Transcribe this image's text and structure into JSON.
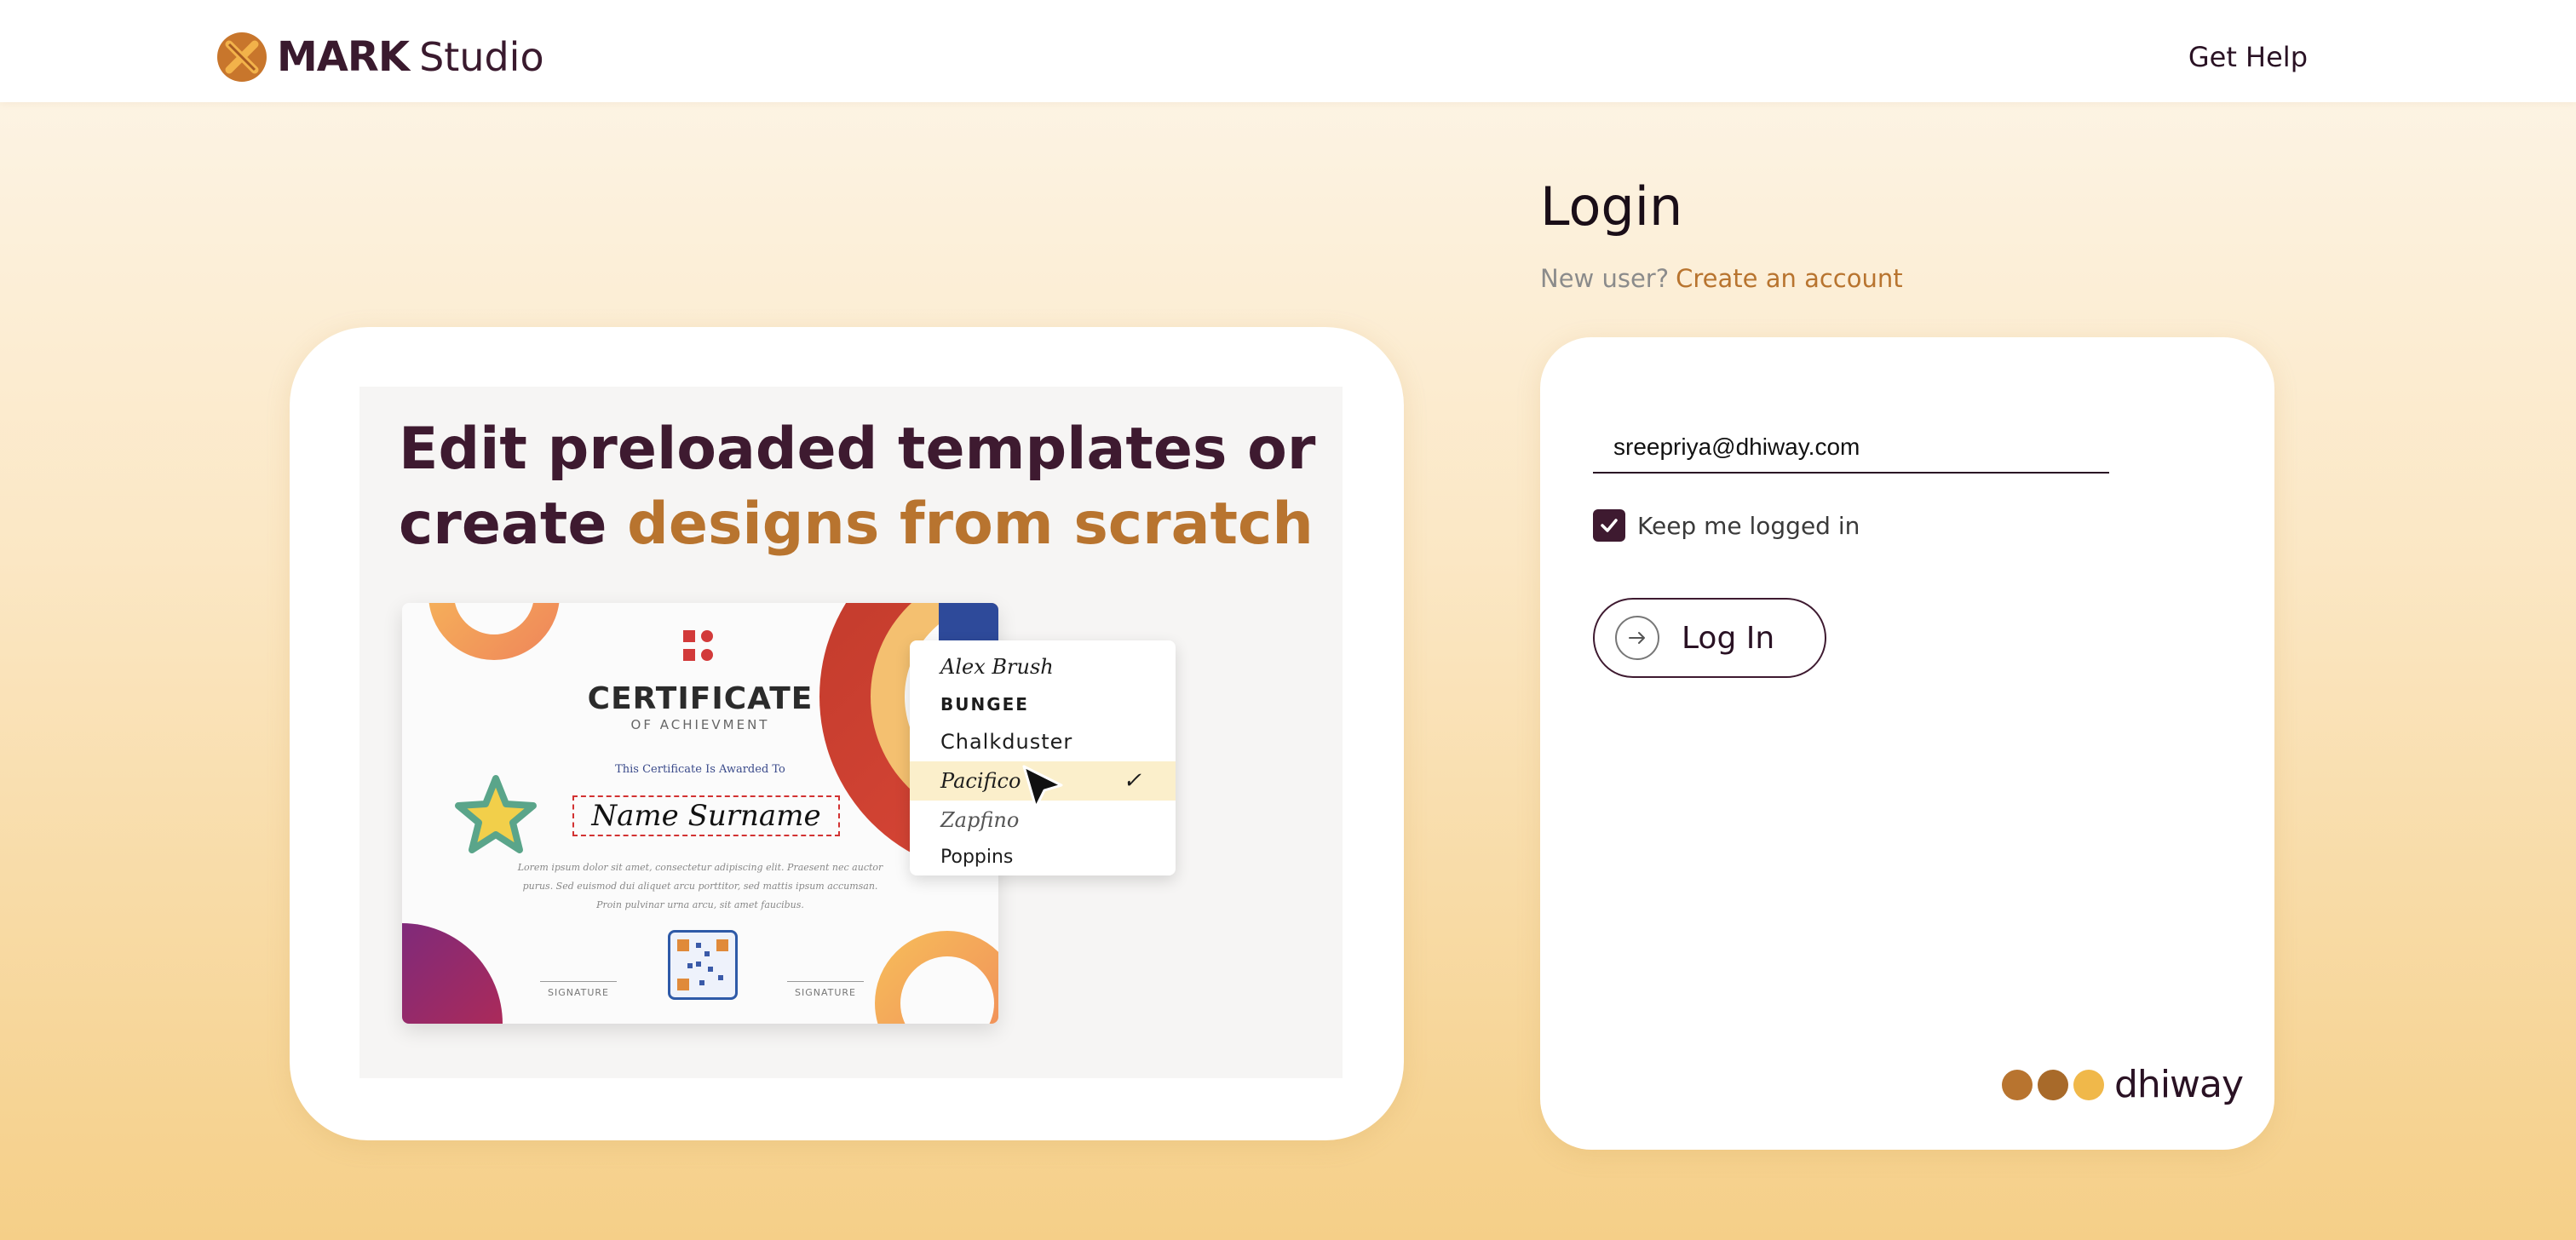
{
  "header": {
    "brand_mark": "MARK",
    "brand_studio": "Studio",
    "help_link": "Get Help"
  },
  "promo": {
    "headline_line1": "Edit preloaded templates or",
    "headline_line2_plain": "create ",
    "headline_line2_accent": "designs from scratch",
    "certificate": {
      "title": "CERTIFICATE",
      "subtitle": "OF ACHIEVMENT",
      "awarded_to": "This Certificate Is Awarded To",
      "name": "Name Surname",
      "lorem": "Lorem ipsum dolor sit amet, consectetur adipiscing elit. Praesent nec auctor purus. Sed euismod dui aliquet arcu porttitor, sed mattis ipsum accumsan. Proin pulvinar urna arcu, sit amet faucibus.",
      "signature_left": "SIGNATURE",
      "signature_right": "SIGNATURE"
    },
    "font_menu": {
      "items": [
        "Alex Brush",
        "BUNGEE",
        "Chalkduster",
        "Pacifico",
        "Zapfino",
        "Poppins"
      ],
      "selected": "Pacifico",
      "check": "✓"
    }
  },
  "login": {
    "title": "Login",
    "new_user_text": "New user?",
    "create_account_link": "Create an account",
    "email_value": "sreepriya@dhiway.com",
    "keep_logged_in_label": "Keep me logged in",
    "keep_logged_in_checked": true,
    "login_button_label": "Log In",
    "footer_brand": "dhiway"
  },
  "colors": {
    "brand_dark": "#3e1a30",
    "accent": "#b8742f",
    "selected_row": "#fbefcb"
  }
}
